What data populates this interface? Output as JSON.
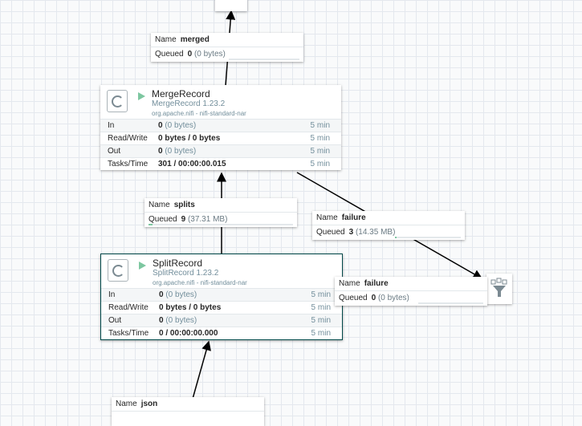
{
  "top_connection": {
    "name_key": "Name",
    "name": "merged",
    "queued_key": "Queued",
    "queued_count": "0",
    "queued_size": "(0 bytes)",
    "fill": 0
  },
  "merge_processor": {
    "name": "MergeRecord",
    "type": "MergeRecord 1.23.2",
    "bundle": "org.apache.nifi - nifi-standard-nar",
    "stats": [
      {
        "label": "In",
        "value": "0",
        "detail": "(0 bytes)",
        "window": "5 min"
      },
      {
        "label": "Read/Write",
        "value": "0 bytes / 0 bytes",
        "detail": "",
        "window": "5 min"
      },
      {
        "label": "Out",
        "value": "0",
        "detail": "(0 bytes)",
        "window": "5 min"
      },
      {
        "label": "Tasks/Time",
        "value": "301 / 00:00:00.015",
        "detail": "",
        "window": "5 min"
      }
    ]
  },
  "splits_connection": {
    "name_key": "Name",
    "name": "splits",
    "queued_key": "Queued",
    "queued_count": "9",
    "queued_size": "(37.31 MB)",
    "fill": 0.02
  },
  "failure_connection_1": {
    "name_key": "Name",
    "name": "failure",
    "queued_key": "Queued",
    "queued_count": "3",
    "queued_size": "(14.35 MB)",
    "fill": 0.01
  },
  "split_processor": {
    "name": "SplitRecord",
    "type": "SplitRecord 1.23.2",
    "bundle": "org.apache.nifi - nifi-standard-nar",
    "stats": [
      {
        "label": "In",
        "value": "0",
        "detail": "(0 bytes)",
        "window": "5 min"
      },
      {
        "label": "Read/Write",
        "value": "0 bytes / 0 bytes",
        "detail": "",
        "window": "5 min"
      },
      {
        "label": "Out",
        "value": "0",
        "detail": "(0 bytes)",
        "window": "5 min"
      },
      {
        "label": "Tasks/Time",
        "value": "0 / 00:00:00.000",
        "detail": "",
        "window": "5 min"
      }
    ]
  },
  "failure_connection_2": {
    "name_key": "Name",
    "name": "failure",
    "queued_key": "Queued",
    "queued_count": "0",
    "queued_size": "(0 bytes)",
    "fill": 0
  },
  "json_connection": {
    "name_key": "Name",
    "name": "json"
  },
  "colors": {
    "accent": "#7dc7a0",
    "selected_border": "#004849",
    "grid": "#e4e8ee"
  }
}
